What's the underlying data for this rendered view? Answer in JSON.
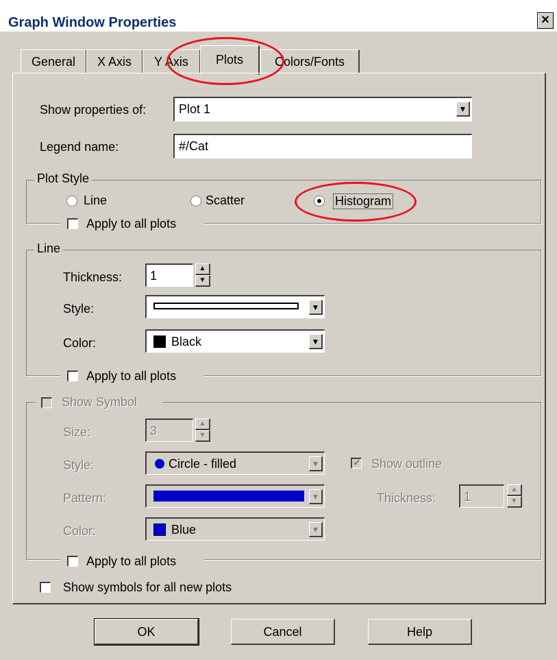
{
  "window": {
    "title": "Graph Window Properties",
    "close_label": "×"
  },
  "tabs": [
    {
      "label": "General"
    },
    {
      "label": "X Axis"
    },
    {
      "label": "Y Axis"
    },
    {
      "label": "Plots"
    },
    {
      "label": "Colors/Fonts"
    }
  ],
  "active_tab": "Plots",
  "show_properties": {
    "label": "Show properties of:",
    "value": "Plot 1"
  },
  "legend_name": {
    "label": "Legend name:",
    "value": "#/Cat"
  },
  "plot_style": {
    "title": "Plot Style",
    "options": [
      "Line",
      "Scatter",
      "Histogram"
    ],
    "selected": "Histogram",
    "apply_all_label": "Apply to all plots"
  },
  "line": {
    "title": "Line",
    "thickness_label": "Thickness:",
    "thickness_value": "1",
    "style_label": "Style:",
    "color_label": "Color:",
    "color_value": "Black",
    "color_hex": "#000000",
    "apply_all_label": "Apply to all plots"
  },
  "symbol": {
    "title": "Show Symbol",
    "enabled": false,
    "size_label": "Size:",
    "size_value": "3",
    "style_label": "Style:",
    "style_value": "Circle - filled",
    "pattern_label": "Pattern:",
    "pattern_hex": "#0000cc",
    "color_label": "Color:",
    "color_value": "Blue",
    "color_hex": "#0000cc",
    "show_outline_label": "Show outline",
    "outline_thickness_label": "Thickness:",
    "outline_thickness_value": "1",
    "apply_all_label": "Apply to all plots"
  },
  "show_symbols_new_label": "Show symbols for all new plots",
  "buttons": {
    "ok": "OK",
    "cancel": "Cancel",
    "help": "Help"
  },
  "annotation_color": "#e8141c"
}
